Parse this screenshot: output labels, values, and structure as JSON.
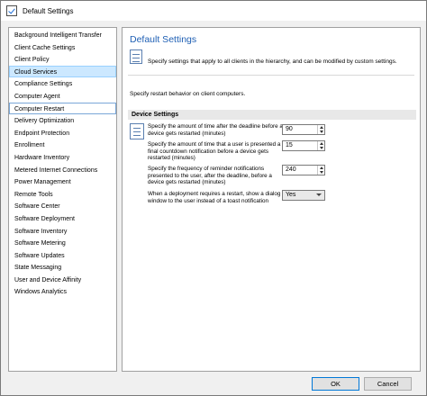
{
  "window": {
    "title": "Default Settings"
  },
  "nav": {
    "items": [
      {
        "label": "Background Intelligent Transfer"
      },
      {
        "label": "Client Cache Settings"
      },
      {
        "label": "Client Policy"
      },
      {
        "label": "Cloud Services"
      },
      {
        "label": "Compliance Settings"
      },
      {
        "label": "Computer Agent"
      },
      {
        "label": "Computer Restart"
      },
      {
        "label": "Delivery Optimization"
      },
      {
        "label": "Endpoint Protection"
      },
      {
        "label": "Enrollment"
      },
      {
        "label": "Hardware Inventory"
      },
      {
        "label": "Metered Internet Connections"
      },
      {
        "label": "Power Management"
      },
      {
        "label": "Remote Tools"
      },
      {
        "label": "Software Center"
      },
      {
        "label": "Software Deployment"
      },
      {
        "label": "Software Inventory"
      },
      {
        "label": "Software Metering"
      },
      {
        "label": "Software Updates"
      },
      {
        "label": "State Messaging"
      },
      {
        "label": "User and Device Affinity"
      },
      {
        "label": "Windows Analytics"
      }
    ],
    "selected": "Cloud Services",
    "focused": "Computer Restart"
  },
  "main": {
    "title": "Default Settings",
    "header_description": "Specify settings that apply to all clients in the hierarchy, and can be modified by custom settings.",
    "restart_description": "Specify restart behavior on client computers.",
    "group_title": "Device Settings",
    "settings": [
      {
        "label": "Specify the amount of time after the deadline before a device gets restarted (minutes)",
        "value": "90",
        "control": "spinner"
      },
      {
        "label": "Specify the amount of time that a user is presented a final countdown notification before a device gets restarted (minutes)",
        "value": "15",
        "control": "spinner"
      },
      {
        "label": "Specify the frequency of reminder notifications presented to the user, after the deadline, before a device gets restarted (minutes)",
        "value": "240",
        "control": "spinner"
      },
      {
        "label": "When a deployment requires a restart, show a dialog window to the user instead of a toast notification",
        "value": "Yes",
        "control": "dropdown"
      }
    ]
  },
  "buttons": {
    "ok": "OK",
    "cancel": "Cancel"
  },
  "colors": {
    "title_accent": "#1e5fb4",
    "selection": "#cce8ff"
  }
}
